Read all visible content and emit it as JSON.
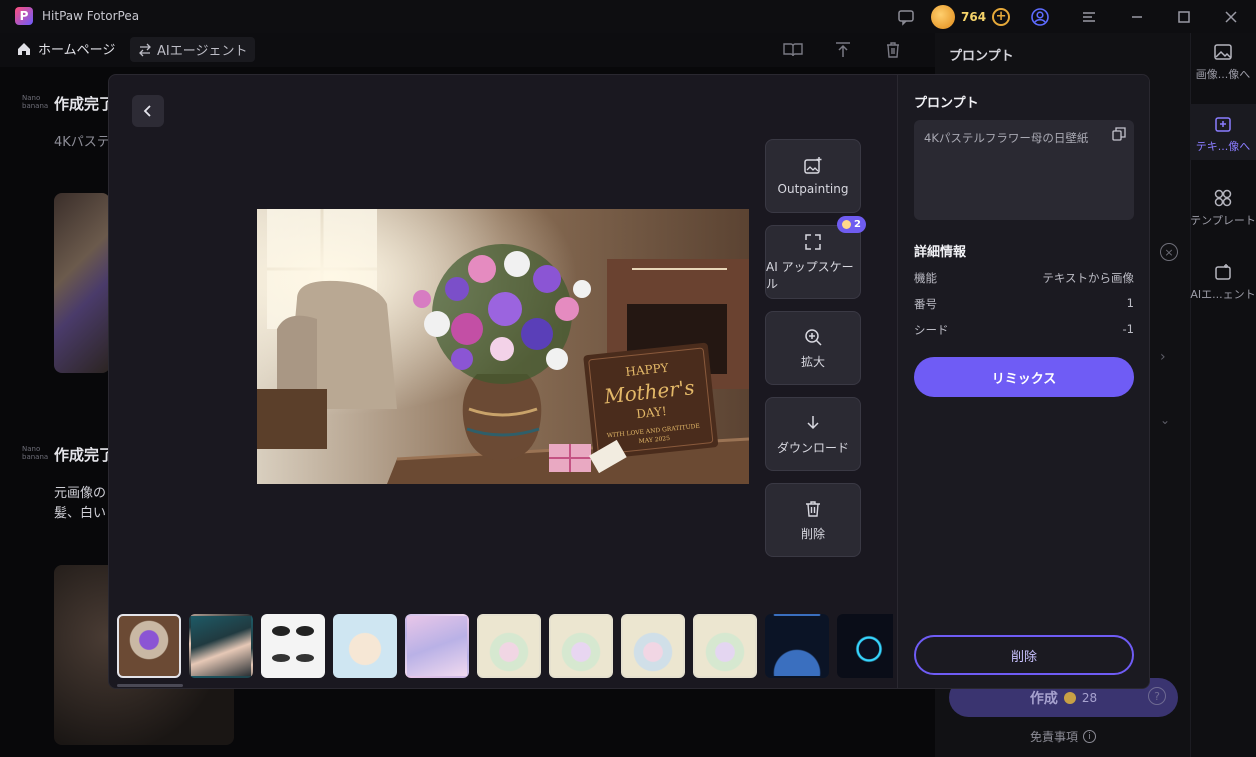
{
  "app": {
    "title": "HitPaw FotorPea",
    "credits": "764"
  },
  "nav": {
    "home_label": "ホームページ",
    "agent_label": "AIエージェント"
  },
  "background": {
    "section1_title": "作成完了",
    "section1_text": "4Kパステ",
    "section2_title": "作成完了",
    "section2_line1": "元画像の",
    "section2_line2": "髪、白い",
    "right_panel_title": "プロンプト",
    "rail": {
      "item1": "画像...像へ",
      "item2": "テキ...像へ",
      "item3": "テンプレート",
      "item4": "AIエ...ェント"
    },
    "create_label": "作成",
    "create_cost": "28",
    "disclaimer": "免責事項"
  },
  "modal": {
    "actions": {
      "outpainting": "Outpainting",
      "upscale": "AI アップスケール",
      "upscale_badge": "2",
      "zoom": "拡大",
      "download": "ダウンロード",
      "delete": "削除"
    },
    "image": {
      "plaque_line1": "HAPPY",
      "plaque_line2": "Mother's",
      "plaque_line3": "DAY!",
      "plaque_line4": "WITH LOVE AND GRATITUDE",
      "plaque_line5": "MAY 2025"
    },
    "side": {
      "prompt_title": "プロンプト",
      "prompt_text": "4Kパステルフラワー母の日壁紙",
      "details_title": "詳細情報",
      "details": [
        {
          "key": "機能",
          "value": "テキストから画像"
        },
        {
          "key": "番号",
          "value": "1"
        },
        {
          "key": "シード",
          "value": "-1"
        }
      ],
      "remix_label": "リミックス",
      "delete_label": "削除"
    },
    "thumbnails": [
      {
        "name": "flower-vase",
        "selected": true
      },
      {
        "name": "woman-portrait",
        "selected": false
      },
      {
        "name": "anime-eyes",
        "selected": false
      },
      {
        "name": "puppy",
        "selected": false
      },
      {
        "name": "anime-girl",
        "selected": false
      },
      {
        "name": "easter-eggs-1",
        "selected": false
      },
      {
        "name": "easter-eggs-2",
        "selected": false
      },
      {
        "name": "easter-eggs-3",
        "selected": false
      },
      {
        "name": "easter-eggs-4",
        "selected": false
      },
      {
        "name": "earth-night",
        "selected": false
      },
      {
        "name": "glowing-planet",
        "selected": false
      }
    ]
  },
  "colors": {
    "accent": "#6f5cf5",
    "modal_bg": "#1a1820",
    "button_bg": "#2b2a33"
  }
}
